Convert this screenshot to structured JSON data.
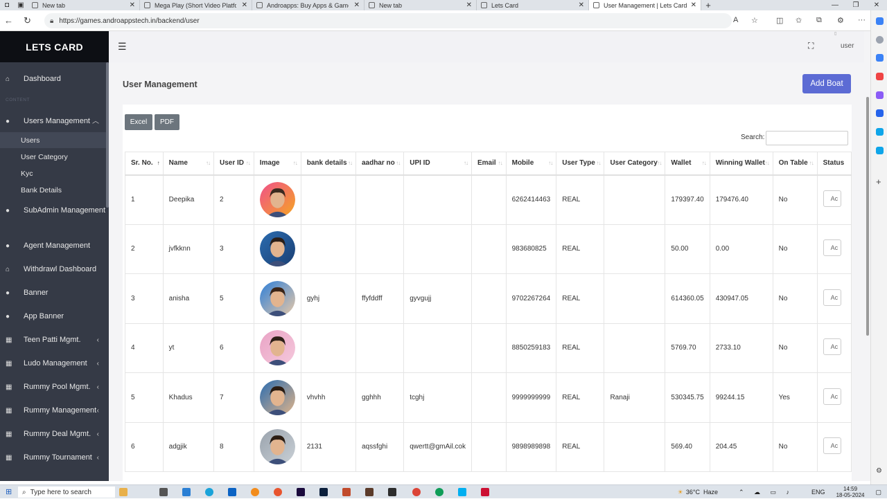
{
  "browser": {
    "tabs": [
      {
        "title": "New tab"
      },
      {
        "title": "Mega Play (Short Video Platform"
      },
      {
        "title": "Androapps: Buy Apps & Games S"
      },
      {
        "title": "New tab"
      },
      {
        "title": "Lets Card"
      },
      {
        "title": "User Management | Lets Card"
      }
    ],
    "url": "https://games.androappstech.in/backend/user"
  },
  "app": {
    "brand": "LETS CARD",
    "user_label": "user",
    "sidebar": {
      "dashboard": "Dashboard",
      "section": "CONTENT",
      "users_management": "Users Management",
      "sub_users": "Users",
      "sub_user_category": "User Category",
      "sub_kyc": "Kyc",
      "sub_bank_details": "Bank Details",
      "subadmin": "SubAdmin Management",
      "agent": "Agent Management",
      "withdrawl": "Withdrawl Dashboard",
      "banner": "Banner",
      "app_banner": "App Banner",
      "teen_patti": "Teen Patti Mgmt.",
      "ludo": "Ludo Management",
      "rummy_pool": "Rummy Pool Mgmt.",
      "rummy_mgmt": "Rummy Management",
      "rummy_deal": "Rummy Deal Mgmt.",
      "rummy_tournament": "Rummy Tournament"
    },
    "page_title": "User Management",
    "add_button": "Add Boat",
    "export": {
      "excel": "Excel",
      "pdf": "PDF"
    },
    "search_label": "Search:",
    "table": {
      "headers": [
        "Sr. No.",
        "Name",
        "User ID",
        "Image",
        "bank details",
        "aadhar no",
        "UPI ID",
        "Email",
        "Mobile",
        "User Type",
        "User Category",
        "Wallet",
        "Winning Wallet",
        "On Table",
        "Status"
      ],
      "action_label": "Ac",
      "rows": [
        {
          "sr": "1",
          "name": "Deepika",
          "uid": "2",
          "bank": "",
          "aadhar": "",
          "upi": "",
          "email": "",
          "mobile": "6262414463",
          "type": "REAL",
          "category": "",
          "wallet": "179397.40",
          "winning": "179476.40",
          "table": "No"
        },
        {
          "sr": "2",
          "name": "jvfkknn",
          "uid": "3",
          "bank": "",
          "aadhar": "",
          "upi": "",
          "email": "",
          "mobile": "983680825",
          "type": "REAL",
          "category": "",
          "wallet": "50.00",
          "winning": "0.00",
          "table": "No"
        },
        {
          "sr": "3",
          "name": "anisha",
          "uid": "5",
          "bank": "gyhj",
          "aadhar": "ffyfddff",
          "upi": "gyvgujj",
          "email": "",
          "mobile": "9702267264",
          "type": "REAL",
          "category": "",
          "wallet": "614360.05",
          "winning": "430947.05",
          "table": "No"
        },
        {
          "sr": "4",
          "name": "yt",
          "uid": "6",
          "bank": "",
          "aadhar": "",
          "upi": "",
          "email": "",
          "mobile": "8850259183",
          "type": "REAL",
          "category": "",
          "wallet": "5769.70",
          "winning": "2733.10",
          "table": "No"
        },
        {
          "sr": "5",
          "name": "Khadus",
          "uid": "7",
          "bank": "vhvhh",
          "aadhar": "gghhh",
          "upi": "tcghj",
          "email": "",
          "mobile": "9999999999",
          "type": "REAL",
          "category": "Ranaji",
          "wallet": "530345.75",
          "winning": "99244.15",
          "table": "Yes"
        },
        {
          "sr": "6",
          "name": "adgjik",
          "uid": "8",
          "bank": "2131",
          "aadhar": "aqssfghi",
          "upi": "qwertt@gmAil.cok",
          "email": "",
          "mobile": "9898989898",
          "type": "REAL",
          "category": "",
          "wallet": "569.40",
          "winning": "204.45",
          "table": "No"
        }
      ]
    }
  },
  "taskbar": {
    "search_placeholder": "Type here to search",
    "weather": "36°C  Haze",
    "lang": "ENG",
    "time": "14:59",
    "date": "18-05-2024"
  },
  "colors": {
    "sidebar": "#353a46",
    "brand_bg": "#0d0f14",
    "accent": "#5c6bd4",
    "export_btn": "#6c757d"
  }
}
